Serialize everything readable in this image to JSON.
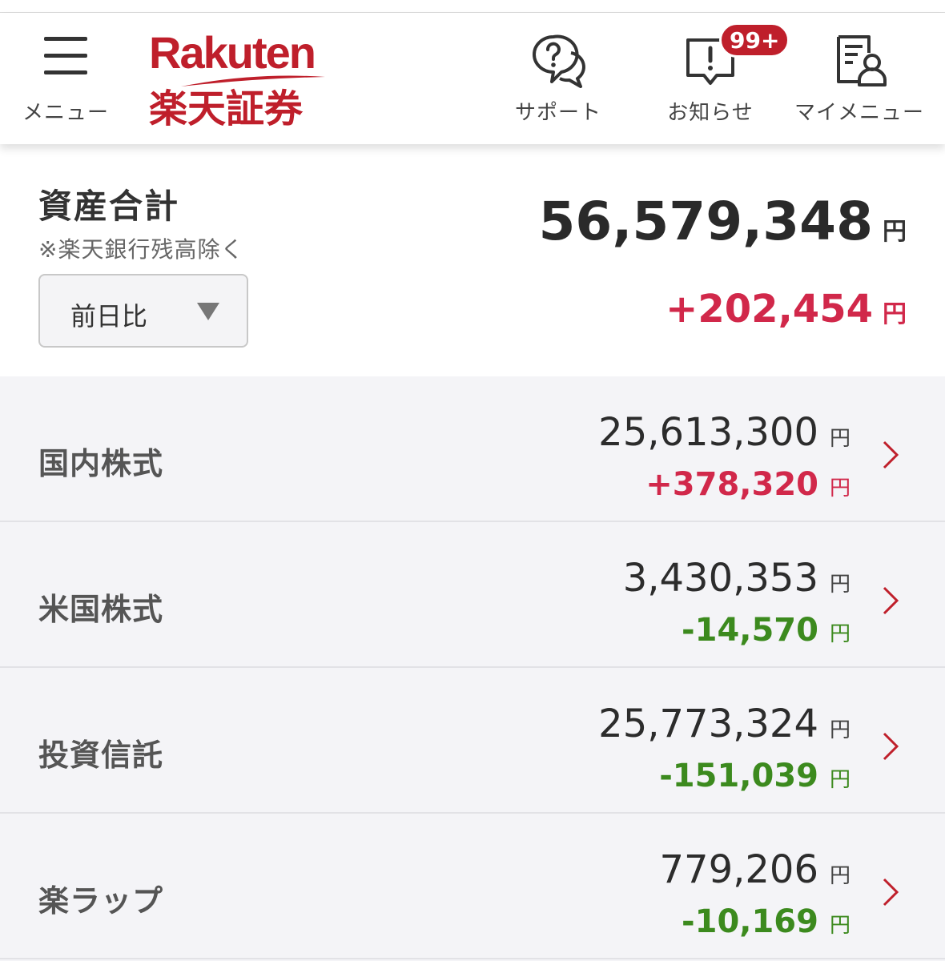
{
  "header": {
    "menu_label": "メニュー",
    "logo_en": "Rakuten",
    "logo_ja": "楽天証券",
    "support_label": "サポート",
    "notice_label": "お知らせ",
    "notice_badge": "99+",
    "mymenu_label": "マイメニュー"
  },
  "summary": {
    "title": "資産合計",
    "note": "※楽天銀行残高除く",
    "period_selected": "前日比",
    "total_value": "56,579,348",
    "total_unit": "円",
    "change_value": "+202,454",
    "change_unit": "円"
  },
  "assets": [
    {
      "name": "国内株式",
      "amount": "25,613,300",
      "amount_unit": "円",
      "change": "+378,320",
      "change_unit": "円",
      "direction": "up"
    },
    {
      "name": "米国株式",
      "amount": "3,430,353",
      "amount_unit": "円",
      "change": "-14,570",
      "change_unit": "円",
      "direction": "down"
    },
    {
      "name": "投資信託",
      "amount": "25,773,324",
      "amount_unit": "円",
      "change": "-151,039",
      "change_unit": "円",
      "direction": "down"
    },
    {
      "name": "楽ラップ",
      "amount": "779,206",
      "amount_unit": "円",
      "change": "-10,169",
      "change_unit": "円",
      "direction": "down"
    }
  ],
  "colors": {
    "brand": "#bf1f2b",
    "positive": "#d1284a",
    "negative": "#3c8a1e"
  }
}
